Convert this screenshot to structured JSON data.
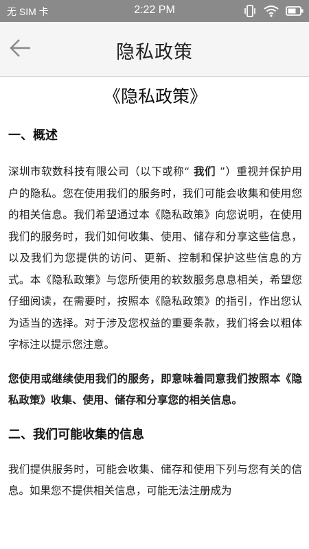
{
  "status_bar": {
    "carrier": "无 SIM 卡",
    "time": "2:22 PM",
    "icons": [
      "vibrate-icon",
      "wifi-icon",
      "battery-icon"
    ]
  },
  "app_bar": {
    "title": "隐私政策",
    "back_icon": "arrow-left-icon"
  },
  "document": {
    "title": "《隐私政策》",
    "section1_heading": "一、概述",
    "para1_before": "深圳市软数科技有限公司（以下或称“",
    "para1_bold": " 我们 ",
    "para1_after": "”）重视并保护用户的隐私。您在使用我们的服务时，我们可能会收集和使用您的相关信息。我们希望通过本《隐私政策》向您说明，在使用我们的服务时，我们如何收集、使用、储存和分享这些信息，以及我们为您提供的访问、更新、控制和保护这些信息的方式。本《隐私政策》与您所使用的软数服务息息相关，希望您仔细阅读，在需要时，按照本《隐私政策》的指引，作出您认为适当的选择。对于涉及您权益的重要条款，我们将会以粗体字标注以提示您注意。",
    "para2": "您使用或继续使用我们的服务，即意味着同意我们按照本《隐私政策》收集、使用、储存和分享您的相关信息。",
    "section2_heading": "二、我们可能收集的信息",
    "para3": "我们提供服务时，可能会收集、储存和使用下列与您有关的信息。如果您不提供相关信息，可能无法注册成为"
  }
}
